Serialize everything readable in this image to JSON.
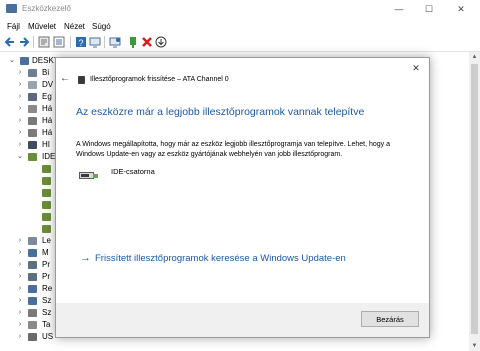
{
  "window": {
    "title": "Eszközkezelő",
    "minimize": "—",
    "maximize": "☐",
    "close": "✕"
  },
  "menu": {
    "items": [
      "Fájl",
      "Művelet",
      "Nézet",
      "Súgó"
    ]
  },
  "toolbar": {
    "icons": [
      "back-arrow-icon",
      "forward-arrow-icon",
      "properties-icon",
      "list-icon",
      "help-icon",
      "monitor-icon",
      "scan-hardware-icon",
      "enable-device-icon",
      "remove-device-icon",
      "update-driver-icon"
    ]
  },
  "tree": {
    "root": "DESKT",
    "items": [
      {
        "label": "Bi",
        "expanded": false
      },
      {
        "label": "DV",
        "expanded": false
      },
      {
        "label": "Eg",
        "expanded": false
      },
      {
        "label": "Há",
        "expanded": false
      },
      {
        "label": "Há",
        "expanded": false
      },
      {
        "label": "Há",
        "expanded": false
      },
      {
        "label": "HI",
        "expanded": false
      },
      {
        "label": "IDE",
        "expanded": true
      },
      {
        "label": "Le",
        "expanded": false
      },
      {
        "label": "M",
        "expanded": false
      },
      {
        "label": "Pr",
        "expanded": false
      },
      {
        "label": "Pr",
        "expanded": false
      },
      {
        "label": "Re",
        "expanded": false
      },
      {
        "label": "Sz",
        "expanded": false
      },
      {
        "label": "Sz",
        "expanded": false
      },
      {
        "label": "Ta",
        "expanded": false
      },
      {
        "label": "US",
        "expanded": false
      }
    ]
  },
  "dialog": {
    "title": "Illesztőprogramok frissítése – ATA Channel 0",
    "heading": "Az eszközre már a legjobb illesztőprogramok vannak telepítve",
    "description": "A Windows megállapította, hogy már az eszköz legjobb illesztőprogramja van telepítve. Lehet, hogy a Windows Update-en vagy az eszköz gyártójának webhelyén van jobb illesztőprogram.",
    "device_name": "IDE-csatorna",
    "link": "Frissített illesztőprogramok keresése a Windows Update-en",
    "close_button": "Bezárás",
    "back": "←",
    "close_x": "✕",
    "link_arrow": "→"
  },
  "colors": {
    "accent": "#1a5aa6",
    "footer": "#f0f0f0"
  }
}
